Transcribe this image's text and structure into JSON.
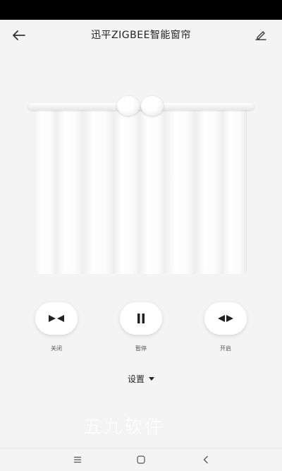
{
  "header": {
    "title": "迅平ZIGBEE智能窗帘",
    "back_icon": "arrow-left-icon",
    "edit_icon": "pencil-icon"
  },
  "controls": [
    {
      "label": "关闭",
      "icon": "close-curtain-icon"
    },
    {
      "label": "暂停",
      "icon": "pause-icon"
    },
    {
      "label": "开启",
      "icon": "open-curtain-icon"
    }
  ],
  "settings": {
    "label": "设置",
    "icon": "caret-down-icon"
  },
  "watermark": "五九软件",
  "navbar": {
    "menu_icon": "menu-icon",
    "home_icon": "home-square-icon",
    "back_icon": "back-chevron-icon"
  }
}
